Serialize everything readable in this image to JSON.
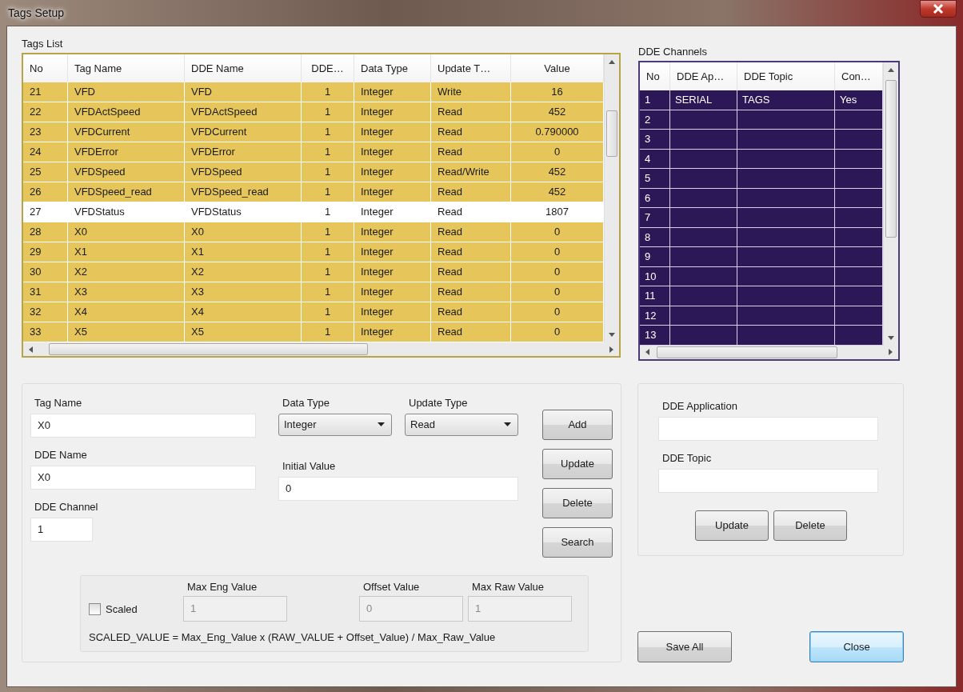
{
  "window": {
    "title": "Tags Setup"
  },
  "tags_list": {
    "label": "Tags List",
    "columns": [
      "No",
      "Tag Name",
      "DDE Name",
      "DDE…",
      "Data Type",
      "Update T…",
      "Value"
    ],
    "rows": [
      {
        "cells": [
          "21",
          "VFD",
          "VFD",
          "1",
          "Integer",
          "Write",
          "16"
        ],
        "selected": true
      },
      {
        "cells": [
          "22",
          "VFDActSpeed",
          "VFDActSpeed",
          "1",
          "Integer",
          "Read",
          "452"
        ],
        "selected": true
      },
      {
        "cells": [
          "23",
          "VFDCurrent",
          "VFDCurrent",
          "1",
          "Integer",
          "Read",
          "0.790000"
        ],
        "selected": true
      },
      {
        "cells": [
          "24",
          "VFDError",
          "VFDError",
          "1",
          "Integer",
          "Read",
          "0"
        ],
        "selected": true
      },
      {
        "cells": [
          "25",
          "VFDSpeed",
          "VFDSpeed",
          "1",
          "Integer",
          "Read/Write",
          "452"
        ],
        "selected": true
      },
      {
        "cells": [
          "26",
          "VFDSpeed_read",
          "VFDSpeed_read",
          "1",
          "Integer",
          "Read",
          "452"
        ],
        "selected": true
      },
      {
        "cells": [
          "27",
          "VFDStatus",
          "VFDStatus",
          "1",
          "Integer",
          "Read",
          "1807"
        ],
        "selected": false
      },
      {
        "cells": [
          "28",
          "X0",
          "X0",
          "1",
          "Integer",
          "Read",
          "0"
        ],
        "selected": true
      },
      {
        "cells": [
          "29",
          "X1",
          "X1",
          "1",
          "Integer",
          "Read",
          "0"
        ],
        "selected": true
      },
      {
        "cells": [
          "30",
          "X2",
          "X2",
          "1",
          "Integer",
          "Read",
          "0"
        ],
        "selected": true
      },
      {
        "cells": [
          "31",
          "X3",
          "X3",
          "1",
          "Integer",
          "Read",
          "0"
        ],
        "selected": true
      },
      {
        "cells": [
          "32",
          "X4",
          "X4",
          "1",
          "Integer",
          "Read",
          "0"
        ],
        "selected": true
      },
      {
        "cells": [
          "33",
          "X5",
          "X5",
          "1",
          "Integer",
          "Read",
          "0"
        ],
        "selected": true
      }
    ]
  },
  "dde_channels": {
    "label": "DDE Channels",
    "columns": [
      "No",
      "DDE Ap…",
      "DDE Topic",
      "Con…"
    ],
    "rows": [
      {
        "cells": [
          "1",
          "SERIAL",
          "TAGS",
          "Yes"
        ],
        "selected": true
      },
      {
        "cells": [
          "2"
        ],
        "selected": true
      },
      {
        "cells": [
          "3"
        ],
        "selected": true
      },
      {
        "cells": [
          "4"
        ],
        "selected": true
      },
      {
        "cells": [
          "5"
        ],
        "selected": true
      },
      {
        "cells": [
          "6"
        ],
        "selected": true
      },
      {
        "cells": [
          "7"
        ],
        "selected": true
      },
      {
        "cells": [
          "8"
        ],
        "selected": true
      },
      {
        "cells": [
          "9"
        ],
        "selected": true
      },
      {
        "cells": [
          "10"
        ],
        "selected": true
      },
      {
        "cells": [
          "11"
        ],
        "selected": true
      },
      {
        "cells": [
          "12"
        ],
        "selected": true
      },
      {
        "cells": [
          "13"
        ],
        "selected": true
      }
    ]
  },
  "tag_form": {
    "tag_name": {
      "label": "Tag Name",
      "value": "X0"
    },
    "dde_name": {
      "label": "DDE Name",
      "value": "X0"
    },
    "dde_channel": {
      "label": "DDE Channel",
      "value": "1"
    },
    "data_type": {
      "label": "Data Type",
      "value": "Integer"
    },
    "update_type": {
      "label": "Update Type",
      "value": "Read"
    },
    "initial_value": {
      "label": "Initial Value",
      "value": "0"
    },
    "buttons": [
      "Add",
      "Update",
      "Delete",
      "Search"
    ]
  },
  "scaling": {
    "scaled": {
      "label": "Scaled",
      "checked": false
    },
    "fields": [
      {
        "label": "Max Eng Value",
        "value": "1",
        "disabled": true
      },
      {
        "label": "Offset Value",
        "value": "0",
        "disabled": true
      },
      {
        "label": "Max Raw Value",
        "value": "1",
        "disabled": true
      }
    ],
    "formula": "SCALED_VALUE = Max_Eng_Value x (RAW_VALUE + Offset_Value) / Max_Raw_Value"
  },
  "channel_form": {
    "application": {
      "label": "DDE Application"
    },
    "topic": {
      "label": "DDE Topic"
    },
    "buttons": [
      "Update",
      "Delete"
    ]
  },
  "footer_buttons": [
    {
      "label": "Save All",
      "default": false
    },
    {
      "label": "Close",
      "default": true
    }
  ]
}
